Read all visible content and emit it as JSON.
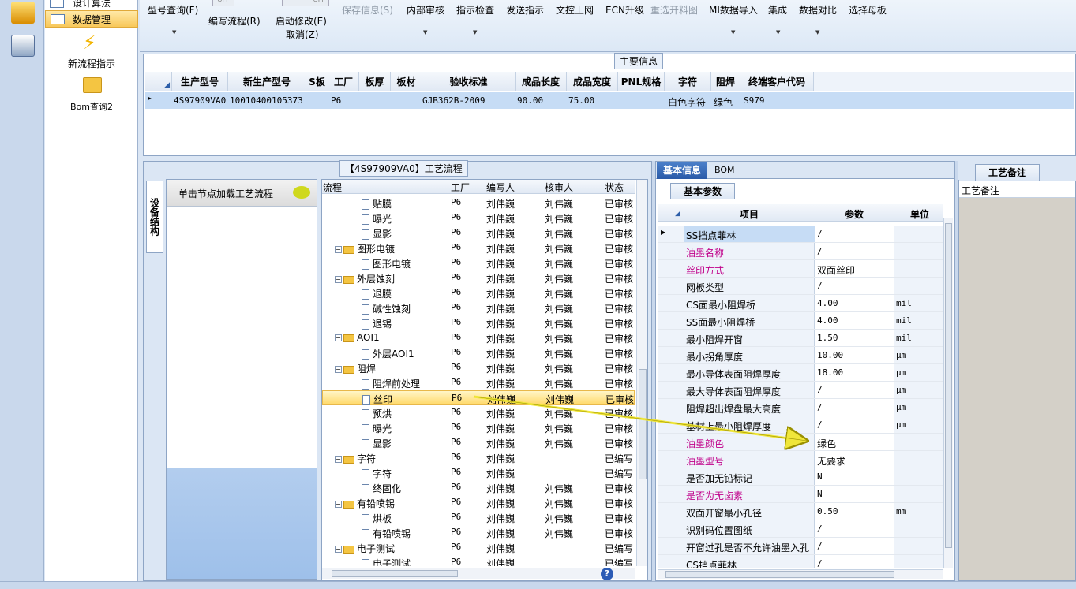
{
  "nav": {
    "item0": "设计算法",
    "item1": "数据管理",
    "item2": "新流程指示",
    "item3": "Bom查询2"
  },
  "toolbar": {
    "t1": "型号查询(F)",
    "t2": "编写流程(R)",
    "t3": "启动修改(E)",
    "t3b": "取消(Z)",
    "t4": "保存信息(S)",
    "t5": "内部审核",
    "t6": "指示检查",
    "t7": "发送指示",
    "t8": "文控上网",
    "t9": "ECN升级",
    "t10": "重选开料图",
    "t11": "MI数据导入",
    "t12": "集成",
    "t13": "数据对比",
    "t14": "选择母板",
    "off1": "OFF",
    "off2": "OFF"
  },
  "main": {
    "title": "主要信息",
    "headers": [
      "生产型号",
      "新生产型号",
      "S板",
      "工厂",
      "板厚",
      "板材",
      "验收标准",
      "成品长度",
      "成品宽度",
      "PNL规格",
      "字符",
      "阻焊",
      "终端客户代码"
    ],
    "row": [
      "4S97909VA0",
      "10010400105373",
      "",
      "P6",
      "",
      "",
      "GJB362B-2009",
      "90.00",
      "75.00",
      "",
      "白色字符",
      "绿色",
      "S979"
    ]
  },
  "process": {
    "title": "【4S97909VA0】工艺流程",
    "side_tab": "设备结构",
    "node_hint": "单击节点加载工艺流程",
    "headers": [
      "流程",
      "工厂",
      "编写人",
      "核审人",
      "状态"
    ],
    "rows": [
      {
        "indent": 2,
        "type": "doc",
        "name": "贴膜",
        "factory": "P6",
        "writer": "刘伟巍",
        "reviewer": "刘伟巍",
        "status": "已审核"
      },
      {
        "indent": 2,
        "type": "doc",
        "name": "曝光",
        "factory": "P6",
        "writer": "刘伟巍",
        "reviewer": "刘伟巍",
        "status": "已审核"
      },
      {
        "indent": 2,
        "type": "doc",
        "name": "显影",
        "factory": "P6",
        "writer": "刘伟巍",
        "reviewer": "刘伟巍",
        "status": "已审核"
      },
      {
        "indent": 1,
        "type": "folder",
        "name": "图形电镀",
        "factory": "P6",
        "writer": "刘伟巍",
        "reviewer": "刘伟巍",
        "status": "已审核"
      },
      {
        "indent": 2,
        "type": "doc",
        "name": "图形电镀",
        "factory": "P6",
        "writer": "刘伟巍",
        "reviewer": "刘伟巍",
        "status": "已审核"
      },
      {
        "indent": 1,
        "type": "folder",
        "name": "外层蚀刻",
        "factory": "P6",
        "writer": "刘伟巍",
        "reviewer": "刘伟巍",
        "status": "已审核"
      },
      {
        "indent": 2,
        "type": "doc",
        "name": "退膜",
        "factory": "P6",
        "writer": "刘伟巍",
        "reviewer": "刘伟巍",
        "status": "已审核"
      },
      {
        "indent": 2,
        "type": "doc",
        "name": "碱性蚀刻",
        "factory": "P6",
        "writer": "刘伟巍",
        "reviewer": "刘伟巍",
        "status": "已审核"
      },
      {
        "indent": 2,
        "type": "doc",
        "name": "退锡",
        "factory": "P6",
        "writer": "刘伟巍",
        "reviewer": "刘伟巍",
        "status": "已审核"
      },
      {
        "indent": 1,
        "type": "folder",
        "name": "AOI1",
        "factory": "P6",
        "writer": "刘伟巍",
        "reviewer": "刘伟巍",
        "status": "已审核"
      },
      {
        "indent": 2,
        "type": "doc",
        "name": "外层AOI1",
        "factory": "P6",
        "writer": "刘伟巍",
        "reviewer": "刘伟巍",
        "status": "已审核"
      },
      {
        "indent": 1,
        "type": "folder",
        "name": "阻焊",
        "factory": "P6",
        "writer": "刘伟巍",
        "reviewer": "刘伟巍",
        "status": "已审核"
      },
      {
        "indent": 2,
        "type": "doc",
        "name": "阻焊前处理",
        "factory": "P6",
        "writer": "刘伟巍",
        "reviewer": "刘伟巍",
        "status": "已审核"
      },
      {
        "indent": 2,
        "type": "doc",
        "name": "丝印",
        "factory": "P6",
        "writer": "刘伟巍",
        "reviewer": "刘伟巍",
        "status": "已审核",
        "selected": true
      },
      {
        "indent": 2,
        "type": "doc",
        "name": "预烘",
        "factory": "P6",
        "writer": "刘伟巍",
        "reviewer": "刘伟巍",
        "status": "已审核"
      },
      {
        "indent": 2,
        "type": "doc",
        "name": "曝光",
        "factory": "P6",
        "writer": "刘伟巍",
        "reviewer": "刘伟巍",
        "status": "已审核"
      },
      {
        "indent": 2,
        "type": "doc",
        "name": "显影",
        "factory": "P6",
        "writer": "刘伟巍",
        "reviewer": "刘伟巍",
        "status": "已审核"
      },
      {
        "indent": 1,
        "type": "folder",
        "name": "字符",
        "factory": "P6",
        "writer": "刘伟巍",
        "reviewer": "",
        "status": "已编写"
      },
      {
        "indent": 2,
        "type": "doc",
        "name": "字符",
        "factory": "P6",
        "writer": "刘伟巍",
        "reviewer": "",
        "status": "已编写"
      },
      {
        "indent": 2,
        "type": "doc",
        "name": "终固化",
        "factory": "P6",
        "writer": "刘伟巍",
        "reviewer": "刘伟巍",
        "status": "已审核"
      },
      {
        "indent": 1,
        "type": "folder",
        "name": "有铅喷锡",
        "factory": "P6",
        "writer": "刘伟巍",
        "reviewer": "刘伟巍",
        "status": "已审核"
      },
      {
        "indent": 2,
        "type": "doc",
        "name": "烘板",
        "factory": "P6",
        "writer": "刘伟巍",
        "reviewer": "刘伟巍",
        "status": "已审核"
      },
      {
        "indent": 2,
        "type": "doc",
        "name": "有铅喷锡",
        "factory": "P6",
        "writer": "刘伟巍",
        "reviewer": "刘伟巍",
        "status": "已审核"
      },
      {
        "indent": 1,
        "type": "folder",
        "name": "电子测试",
        "factory": "P6",
        "writer": "刘伟巍",
        "reviewer": "",
        "status": "已编写"
      },
      {
        "indent": 2,
        "type": "doc",
        "name": "电子测试",
        "factory": "P6",
        "writer": "刘伟巍",
        "reviewer": "",
        "status": "已编写"
      }
    ]
  },
  "detail": {
    "tab_basic": "基本信息",
    "tab_bom": "BOM",
    "subtab": "基本参数",
    "headers": [
      "项目",
      "参数",
      "单位"
    ],
    "rows": [
      {
        "item": "SS挡点菲林",
        "value": "/",
        "unit": "",
        "pink": false,
        "current": true
      },
      {
        "item": "油墨名称",
        "value": "/",
        "unit": "",
        "pink": true
      },
      {
        "item": "丝印方式",
        "value": "双面丝印",
        "unit": "",
        "pink": true
      },
      {
        "item": "网板类型",
        "value": "/",
        "unit": "",
        "pink": false
      },
      {
        "item": "CS面最小阻焊桥",
        "value": "4.00",
        "unit": "mil",
        "pink": false
      },
      {
        "item": "SS面最小阻焊桥",
        "value": "4.00",
        "unit": "mil",
        "pink": false
      },
      {
        "item": "最小阻焊开窗",
        "value": "1.50",
        "unit": "mil",
        "pink": false
      },
      {
        "item": "最小拐角厚度",
        "value": "10.00",
        "unit": "μm",
        "pink": false
      },
      {
        "item": "最小导体表面阻焊厚度",
        "value": "18.00",
        "unit": "μm",
        "pink": false
      },
      {
        "item": "最大导体表面阻焊厚度",
        "value": "/",
        "unit": "μm",
        "pink": false
      },
      {
        "item": "阻焊超出焊盘最大高度",
        "value": "/",
        "unit": "μm",
        "pink": false
      },
      {
        "item": "基材上最小阻焊厚度",
        "value": "/",
        "unit": "μm",
        "pink": false
      },
      {
        "item": "油墨颜色",
        "value": "绿色",
        "unit": "",
        "pink": true
      },
      {
        "item": "油墨型号",
        "value": "无要求",
        "unit": "",
        "pink": true
      },
      {
        "item": "是否加无铅标记",
        "value": "N",
        "unit": "",
        "pink": false
      },
      {
        "item": "是否为无卤素",
        "value": "N",
        "unit": "",
        "pink": true
      },
      {
        "item": "双面开窗最小孔径",
        "value": "0.50",
        "unit": "mm",
        "pink": false
      },
      {
        "item": "识别码位置图纸",
        "value": "/",
        "unit": "",
        "pink": false
      },
      {
        "item": "开窗过孔是否不允许油墨入孔",
        "value": "/",
        "unit": "",
        "pink": false
      },
      {
        "item": "CS挡点菲林",
        "value": "/",
        "unit": "",
        "pink": false
      }
    ]
  },
  "remark": {
    "tab": "工艺备注",
    "label": "工艺备注"
  }
}
